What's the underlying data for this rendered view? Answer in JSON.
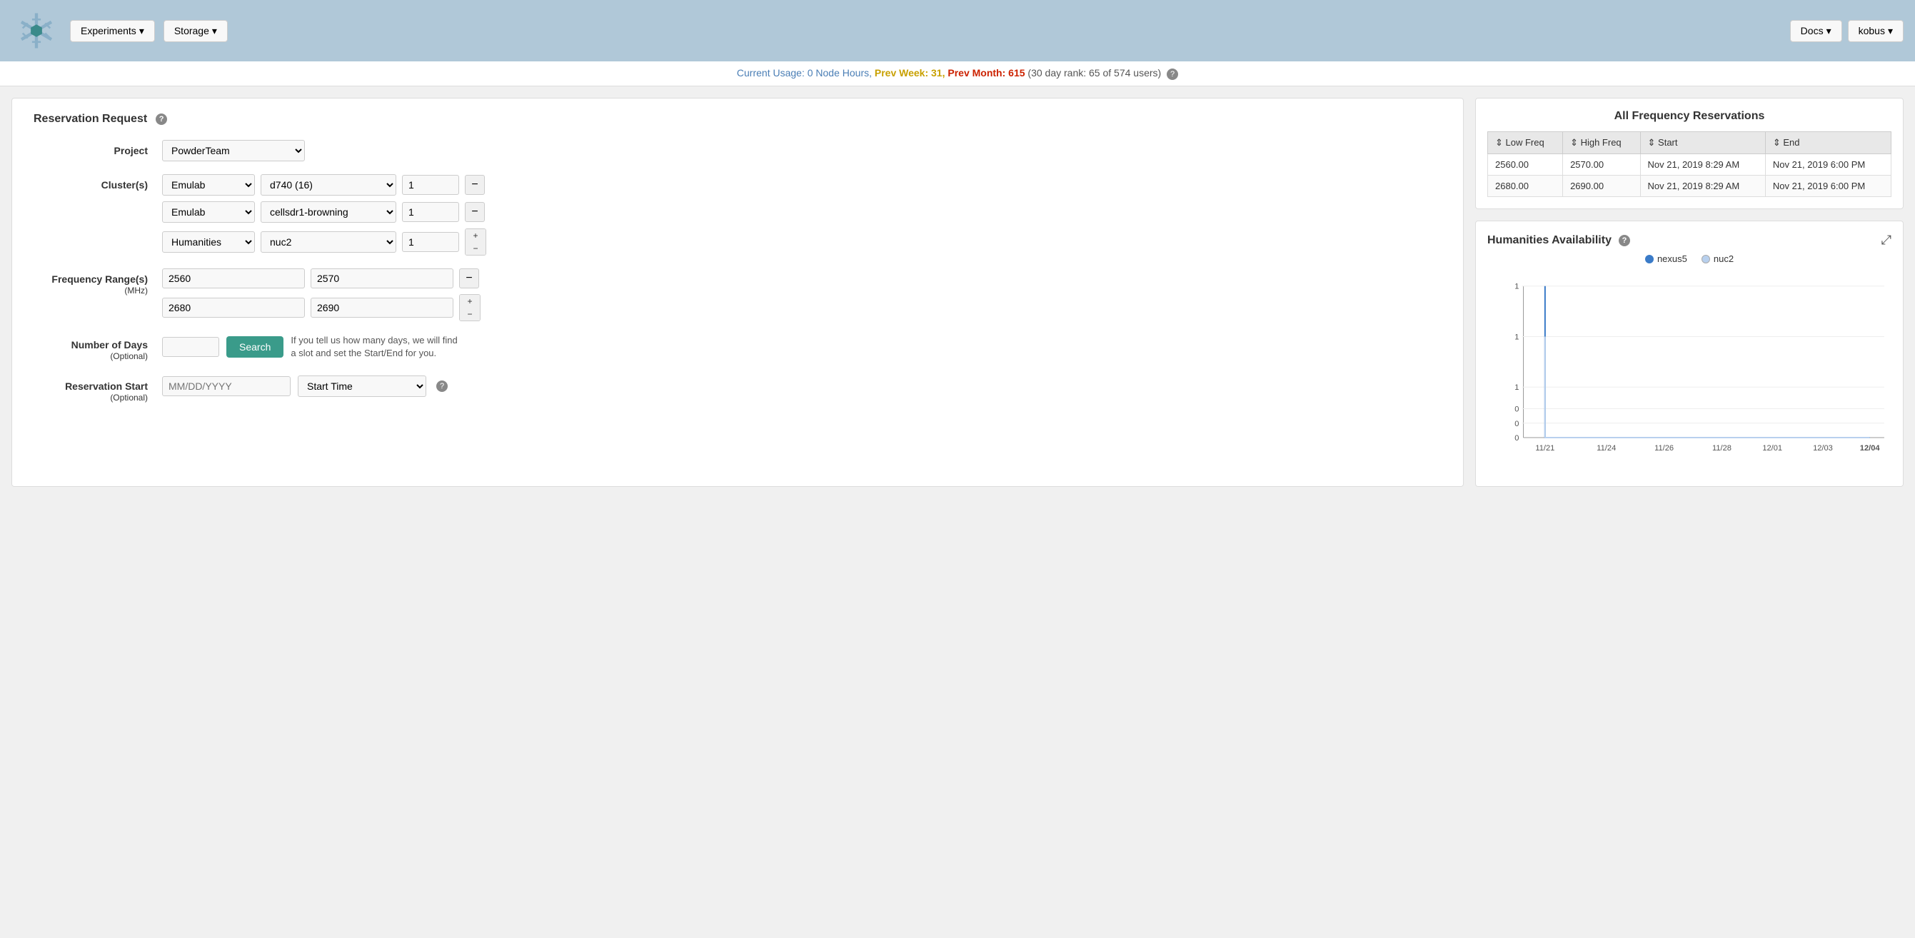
{
  "header": {
    "experiments_label": "Experiments",
    "storage_label": "Storage",
    "docs_label": "Docs",
    "user_label": "kobus"
  },
  "usage_bar": {
    "prefix": "Current Usage: 0 Node Hours,",
    "prev_week_label": "Prev Week:",
    "prev_week_value": "31",
    "prev_month_label": "Prev Month:",
    "prev_month_value": "615",
    "rank_text": "(30 day rank: 65 of 574 users)"
  },
  "reservation_form": {
    "title": "Reservation Request",
    "project_label": "Project",
    "project_value": "PowderTeam",
    "cluster_label": "Cluster(s)",
    "clusters": [
      {
        "cluster": "Emulab",
        "node": "d740 (16)",
        "count": "1"
      },
      {
        "cluster": "Emulab",
        "node": "cellsdr1-browning",
        "count": "1"
      },
      {
        "cluster": "Humanities",
        "node": "nuc2",
        "count": "1"
      }
    ],
    "freq_label": "Frequency Range(s)",
    "freq_sublabel": "(MHz)",
    "frequencies": [
      {
        "low": "2560",
        "high": "2570"
      },
      {
        "low": "2680",
        "high": "2690"
      }
    ],
    "days_label": "Number of Days",
    "days_sublabel": "(Optional)",
    "days_value": "",
    "days_placeholder": "",
    "search_label": "Search",
    "days_hint_line1": "If you tell us how many days, we will find",
    "days_hint_line2": "a slot and set the Start/End for you.",
    "start_label": "Reservation Start",
    "start_sublabel": "(Optional)",
    "start_date_placeholder": "MM/DD/YYYY",
    "start_time_placeholder": "Start Time",
    "cluster_options": [
      "Emulab",
      "Humanities"
    ],
    "node_options_emulab": [
      "d740 (16)",
      "cellsdr1-browning"
    ],
    "node_options_humanities": [
      "nuc2"
    ]
  },
  "freq_table": {
    "title": "All Frequency Reservations",
    "columns": [
      "Low Freq",
      "High Freq",
      "Start",
      "End"
    ],
    "rows": [
      {
        "low": "2560.00",
        "high": "2570.00",
        "start": "Nov 21, 2019 8:29 AM",
        "end": "Nov 21, 2019 6:00 PM"
      },
      {
        "low": "2680.00",
        "high": "2690.00",
        "start": "Nov 21, 2019 8:29 AM",
        "end": "Nov 21, 2019 6:00 PM"
      }
    ]
  },
  "chart": {
    "title": "Humanities Availability",
    "legend": [
      {
        "label": "nexus5",
        "type": "solid"
      },
      {
        "label": "nuc2",
        "type": "light"
      }
    ],
    "x_labels": [
      "11/21",
      "11/24",
      "11/26",
      "11/28",
      "12/01",
      "12/03",
      "12/04"
    ],
    "y_labels": [
      "1",
      "1",
      "1",
      "0",
      "0",
      "0"
    ]
  }
}
